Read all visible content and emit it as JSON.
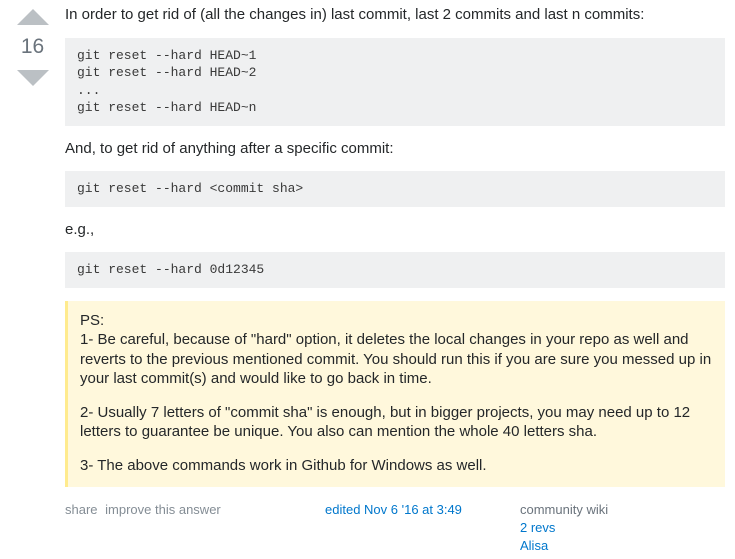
{
  "vote": {
    "count": "16"
  },
  "body": {
    "intro": "In order to get rid of (all the changes in) last commit, last 2 commits and last n commits:",
    "code1": "git reset --hard HEAD~1\ngit reset --hard HEAD~2\n...\ngit reset --hard HEAD~n",
    "para2": "And, to get rid of anything after a specific commit:",
    "code2": "git reset --hard <commit sha>",
    "para3": "e.g.,",
    "code3": "git reset --hard 0d12345",
    "ps": {
      "label": "PS:",
      "item1": "1- Be careful, because of \"hard\" option, it deletes the local changes in your repo as well and reverts to the previous mentioned commit. You should run this if you are sure you messed up in your last commit(s) and would like to go back in time.",
      "item2": "2- Usually 7 letters of \"commit sha\" is enough, but in bigger projects, you may need up to 12 letters to guarantee be unique. You also can mention the whole 40 letters sha.",
      "item3": "3- The above commands work in Github for Windows as well."
    }
  },
  "menu": {
    "share": "share",
    "improve": "improve this answer",
    "edited": "edited Nov 6 '16 at 3:49",
    "community": "community wiki",
    "revs": "2 revs",
    "author": "Alisa"
  }
}
